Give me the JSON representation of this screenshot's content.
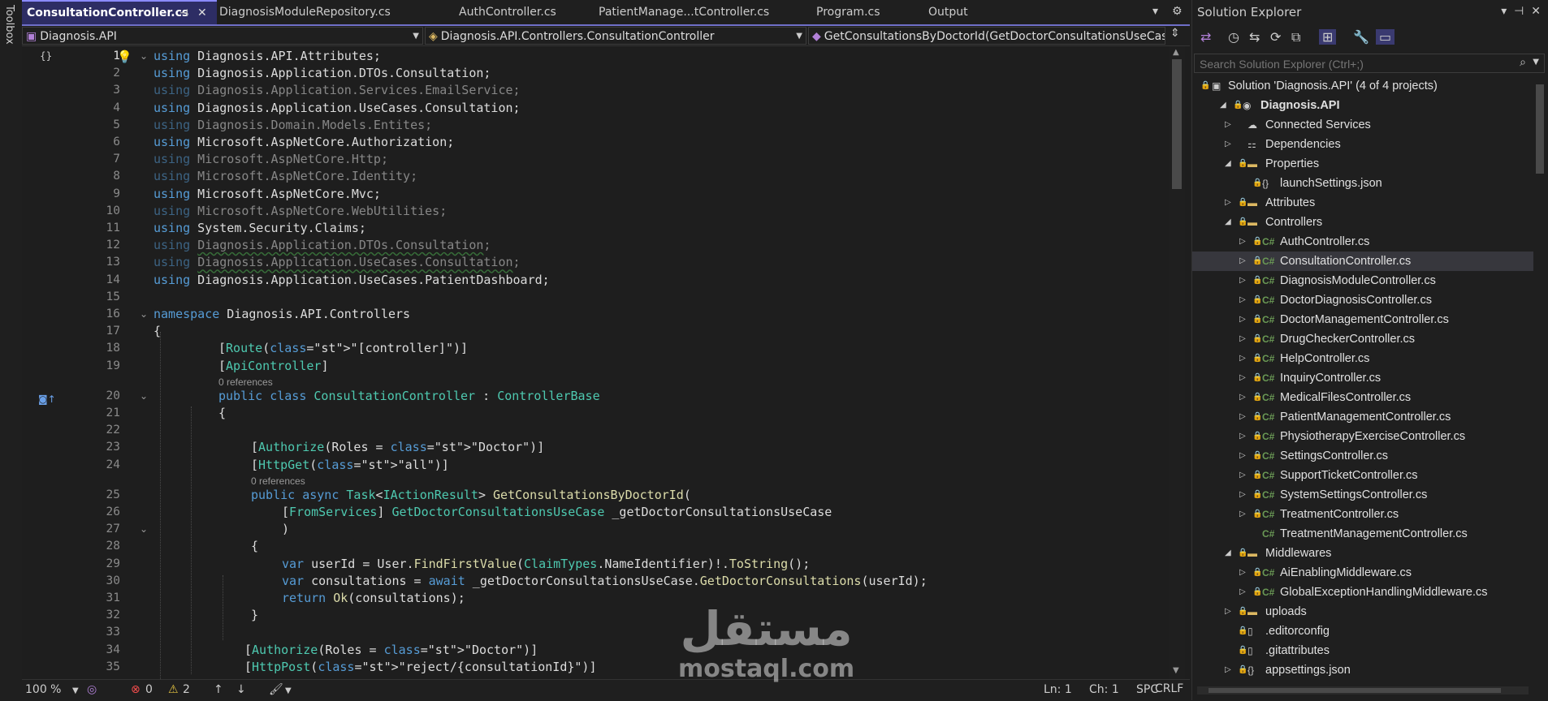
{
  "toolbox": {
    "label": "Toolbox"
  },
  "tabs": [
    {
      "label": "ConsultationController.cs",
      "active": true
    },
    {
      "label": "DiagnosisModuleRepository.cs",
      "active": false
    },
    {
      "label": "AuthController.cs",
      "active": false
    },
    {
      "label": "PatientManage...tController.cs",
      "active": false
    },
    {
      "label": "Program.cs",
      "active": false
    },
    {
      "label": "Output",
      "active": false
    }
  ],
  "navbar": {
    "project": "Diagnosis.API",
    "type": "Diagnosis.API.Controllers.ConsultationController",
    "member": "GetConsultationsByDoctorId(GetDoctorConsultationsUseCase _g"
  },
  "code": {
    "references": "0 references",
    "lines": [
      {
        "n": "1",
        "t": "using Diagnosis.API.Attributes;"
      },
      {
        "n": "2",
        "t": "using Diagnosis.Application.DTOs.Consultation;"
      },
      {
        "n": "3",
        "t": "using Diagnosis.Application.Services.EmailService;"
      },
      {
        "n": "4",
        "t": "using Diagnosis.Application.UseCases.Consultation;"
      },
      {
        "n": "5",
        "t": "using Diagnosis.Domain.Models.Entites;"
      },
      {
        "n": "6",
        "t": "using Microsoft.AspNetCore.Authorization;"
      },
      {
        "n": "7",
        "t": "using Microsoft.AspNetCore.Http;"
      },
      {
        "n": "8",
        "t": "using Microsoft.AspNetCore.Identity;"
      },
      {
        "n": "9",
        "t": "using Microsoft.AspNetCore.Mvc;"
      },
      {
        "n": "10",
        "t": "using Microsoft.AspNetCore.WebUtilities;"
      },
      {
        "n": "11",
        "t": "using System.Security.Claims;"
      },
      {
        "n": "12",
        "t": "using Diagnosis.Application.DTOs.Consultation;"
      },
      {
        "n": "13",
        "t": "using Diagnosis.Application.UseCases.Consultation;"
      },
      {
        "n": "14",
        "t": "using Diagnosis.Application.UseCases.PatientDashboard;"
      },
      {
        "n": "15",
        "t": ""
      },
      {
        "n": "16",
        "t": "namespace Diagnosis.API.Controllers"
      },
      {
        "n": "17",
        "t": "{"
      },
      {
        "n": "18",
        "t": "[Route(\"[controller]\")]"
      },
      {
        "n": "19",
        "t": "[ApiController]"
      },
      {
        "n": "20",
        "t": "public class ConsultationController : ControllerBase"
      },
      {
        "n": "21",
        "t": "{"
      },
      {
        "n": "22",
        "t": ""
      },
      {
        "n": "23",
        "t": "[Authorize(Roles = \"Doctor\")]"
      },
      {
        "n": "24",
        "t": "[HttpGet(\"all\")]"
      },
      {
        "n": "25",
        "t": "public async Task<IActionResult> GetConsultationsByDoctorId("
      },
      {
        "n": "26",
        "t": "[FromServices] GetDoctorConsultationsUseCase _getDoctorConsultationsUseCase"
      },
      {
        "n": "27",
        "t": ")"
      },
      {
        "n": "28",
        "t": "{"
      },
      {
        "n": "29",
        "t": "var userId = User.FindFirstValue(ClaimTypes.NameIdentifier)!.ToString();"
      },
      {
        "n": "30",
        "t": "var consultations = await _getDoctorConsultationsUseCase.GetDoctorConsultations(userId);"
      },
      {
        "n": "31",
        "t": "return Ok(consultations);"
      },
      {
        "n": "32",
        "t": "}"
      },
      {
        "n": "33",
        "t": ""
      },
      {
        "n": "34",
        "t": "[Authorize(Roles = \"Doctor\")]"
      },
      {
        "n": "35",
        "t": "[HttpPost(\"reject/{consultationId}\")]"
      }
    ]
  },
  "status": {
    "zoom": "100 %",
    "errors": "0",
    "warnings": "2",
    "line": "Ln: 1",
    "col": "Ch: 1",
    "spc": "SPC",
    "eol": "CRLF"
  },
  "solution_explorer": {
    "title": "Solution Explorer",
    "search_placeholder": "Search Solution Explorer (Ctrl+;)",
    "nodes": [
      {
        "label": "Solution 'Diagnosis.API' (4 of 4 projects)",
        "kind": "solution"
      },
      {
        "label": "Diagnosis.API",
        "kind": "project"
      },
      {
        "label": "Connected Services",
        "kind": "service"
      },
      {
        "label": "Dependencies",
        "kind": "deps"
      },
      {
        "label": "Properties",
        "kind": "folder"
      },
      {
        "label": "launchSettings.json",
        "kind": "json"
      },
      {
        "label": "Attributes",
        "kind": "folder"
      },
      {
        "label": "Controllers",
        "kind": "folder"
      },
      {
        "label": "AuthController.cs",
        "kind": "cs"
      },
      {
        "label": "ConsultationController.cs",
        "kind": "cs"
      },
      {
        "label": "DiagnosisModuleController.cs",
        "kind": "cs"
      },
      {
        "label": "DoctorDiagnosisController.cs",
        "kind": "cs"
      },
      {
        "label": "DoctorManagementController.cs",
        "kind": "cs"
      },
      {
        "label": "DrugCheckerController.cs",
        "kind": "cs"
      },
      {
        "label": "HelpController.cs",
        "kind": "cs"
      },
      {
        "label": "InquiryController.cs",
        "kind": "cs"
      },
      {
        "label": "MedicalFilesController.cs",
        "kind": "cs"
      },
      {
        "label": "PatientManagementController.cs",
        "kind": "cs"
      },
      {
        "label": "PhysiotherapyExerciseController.cs",
        "kind": "cs"
      },
      {
        "label": "SettingsController.cs",
        "kind": "cs"
      },
      {
        "label": "SupportTicketController.cs",
        "kind": "cs"
      },
      {
        "label": "SystemSettingsController.cs",
        "kind": "cs"
      },
      {
        "label": "TreatmentController.cs",
        "kind": "cs"
      },
      {
        "label": "TreatmentManagementController.cs",
        "kind": "cs"
      },
      {
        "label": "Middlewares",
        "kind": "folder"
      },
      {
        "label": "AiEnablingMiddleware.cs",
        "kind": "cs"
      },
      {
        "label": "GlobalExceptionHandlingMiddleware.cs",
        "kind": "cs"
      },
      {
        "label": "uploads",
        "kind": "folder"
      },
      {
        "label": ".editorconfig",
        "kind": "file"
      },
      {
        "label": ".gitattributes",
        "kind": "file"
      },
      {
        "label": "appsettings.json",
        "kind": "json"
      }
    ]
  },
  "watermark": {
    "arabic": "مستقل",
    "latin": "mostaql.com"
  },
  "colors": {
    "accent": "#6f6fc8",
    "keyword": "#569cd6",
    "type": "#4ec9b0",
    "string": "#d69d85"
  }
}
